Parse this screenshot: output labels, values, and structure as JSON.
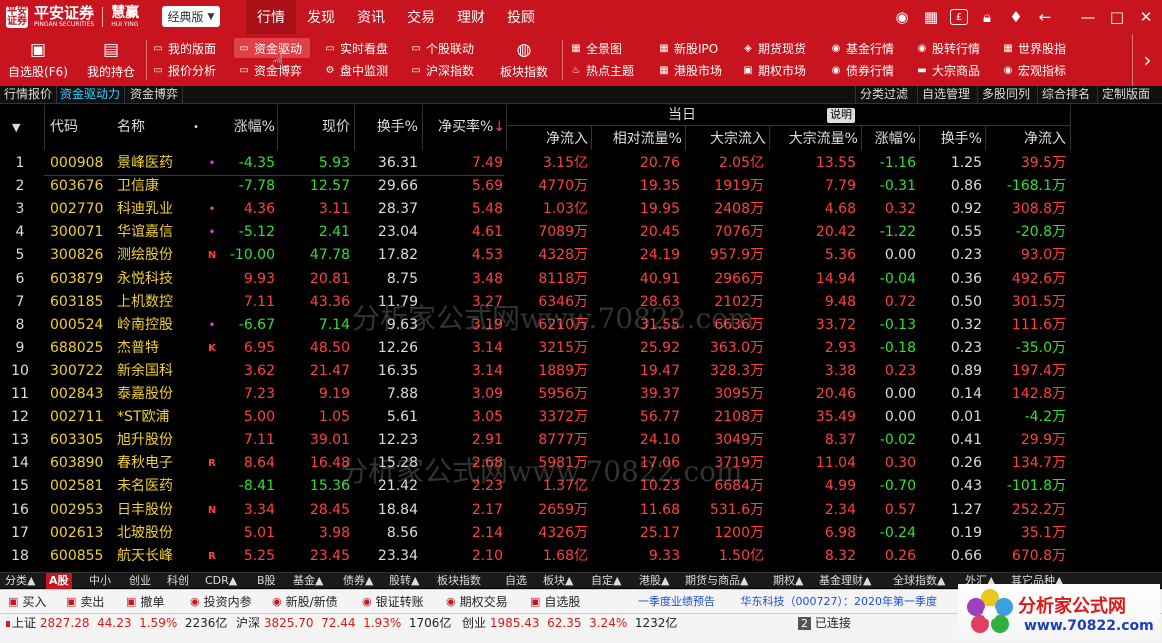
{
  "brand": {
    "badge": "平安\n证券",
    "name": "平安证券",
    "name_sub": "PINGAN SECURITIES",
    "product": "慧赢",
    "product_sub": "HUI YING"
  },
  "mode_select": {
    "value": "经典版"
  },
  "top_nav": [
    {
      "label": "行情",
      "active": true
    },
    {
      "label": "发现"
    },
    {
      "label": "资讯"
    },
    {
      "label": "交易"
    },
    {
      "label": "理财"
    },
    {
      "label": "投顾"
    }
  ],
  "top_icons": [
    "user-icon",
    "grid-icon",
    "account-icon",
    "lock-icon",
    "shirt-icon",
    "back-arrow-icon"
  ],
  "window_controls": {
    "minimize": "—",
    "maximize": "□",
    "close": "✕"
  },
  "toolbar": {
    "big_buttons": [
      {
        "label": "自选股(F6)",
        "icon": "bookmark-icon"
      },
      {
        "label": "我的持仓",
        "icon": "portfolio-icon"
      },
      {
        "label": "板块指数",
        "icon": "globe-icon"
      }
    ],
    "small_buttons": [
      {
        "label": "我的版面",
        "icon": "layout-icon"
      },
      {
        "label": "报价分析",
        "icon": "analysis-icon"
      },
      {
        "label": "资金驱动",
        "icon": "capital-drive-icon",
        "active": true
      },
      {
        "label": "资金博弈",
        "icon": "capital-game-icon"
      },
      {
        "label": "实时看盘",
        "icon": "realtime-icon"
      },
      {
        "label": "盘中监测",
        "icon": "monitor-icon"
      },
      {
        "label": "个股联动",
        "icon": "link-icon"
      },
      {
        "label": "沪深指数",
        "icon": "index-icon"
      },
      {
        "label": "全景图",
        "icon": "panorama-icon"
      },
      {
        "label": "热点主题",
        "icon": "flame-icon"
      },
      {
        "label": "新股IPO",
        "icon": "ipo-icon"
      },
      {
        "label": "港股市场",
        "icon": "hk-icon"
      },
      {
        "label": "期货现货",
        "icon": "futures-icon"
      },
      {
        "label": "期权市场",
        "icon": "options-icon"
      },
      {
        "label": "基金行情",
        "icon": "fund-icon"
      },
      {
        "label": "债券行情",
        "icon": "bond-icon"
      },
      {
        "label": "股转行情",
        "icon": "neeq-icon"
      },
      {
        "label": "大宗商品",
        "icon": "commodity-icon"
      },
      {
        "label": "世界股指",
        "icon": "world-icon"
      },
      {
        "label": "宏观指标",
        "icon": "macro-icon"
      }
    ],
    "more_arrow": "›"
  },
  "sub_tabs": [
    {
      "label": "行情报价"
    },
    {
      "label": "资金驱动力",
      "active": true
    },
    {
      "label": "资金博弈"
    }
  ],
  "filter_tabs": [
    "分类过滤",
    "自选管理",
    "多股同列",
    "综合排名",
    "定制版面"
  ],
  "table": {
    "group_title": "当日",
    "explain_label": "说明",
    "sort_caret": "▼",
    "headers": {
      "code": "代码",
      "name": "名称",
      "name_dot": "•",
      "change_pct": "涨幅%",
      "price": "现价",
      "turnover": "换手%",
      "net_buy_rate": "净买率%",
      "net_buy_arrow": "↓",
      "net_inflow": "净流入",
      "rel_flow": "相对流量%",
      "block_inflow": "大宗流入",
      "block_flow": "大宗流量%",
      "change_pct2": "涨幅%",
      "turnover2": "换手%",
      "net_inflow2": "净流入"
    },
    "rows": [
      {
        "idx": "1",
        "code": "000908",
        "name": "景峰医药",
        "flag": "•",
        "chg": "-4.35",
        "price": "5.93",
        "turn": "36.31",
        "nbr": "7.49",
        "inflow": "3.15亿",
        "rel": "20.76",
        "block": "2.05亿",
        "bflow": "13.55",
        "chg2": "-1.16",
        "turn2": "1.25",
        "inflow2": "39.5万"
      },
      {
        "idx": "2",
        "code": "603676",
        "name": "卫信康",
        "flag": "",
        "chg": "-7.78",
        "price": "12.57",
        "turn": "29.66",
        "nbr": "5.69",
        "inflow": "4770万",
        "rel": "19.35",
        "block": "1919万",
        "bflow": "7.79",
        "chg2": "-0.31",
        "turn2": "0.86",
        "inflow2": "-168.1万"
      },
      {
        "idx": "3",
        "code": "002770",
        "name": "科迪乳业",
        "flag": "•",
        "chg": "4.36",
        "price": "3.11",
        "turn": "28.37",
        "nbr": "5.48",
        "inflow": "1.03亿",
        "rel": "19.95",
        "block": "2408万",
        "bflow": "4.68",
        "chg2": "0.32",
        "turn2": "0.92",
        "inflow2": "308.8万"
      },
      {
        "idx": "4",
        "code": "300071",
        "name": "华谊嘉信",
        "flag": "•",
        "chg": "-5.12",
        "price": "2.41",
        "turn": "23.04",
        "nbr": "4.61",
        "inflow": "7089万",
        "rel": "20.45",
        "block": "7076万",
        "bflow": "20.42",
        "chg2": "-1.22",
        "turn2": "0.55",
        "inflow2": "-20.8万"
      },
      {
        "idx": "5",
        "code": "300826",
        "name": "测绘股份",
        "flag": "N",
        "chg": "-10.00",
        "price": "47.78",
        "turn": "17.82",
        "nbr": "4.53",
        "inflow": "4328万",
        "rel": "24.19",
        "block": "957.9万",
        "bflow": "5.36",
        "chg2": "0.00",
        "turn2": "0.23",
        "inflow2": "93.0万"
      },
      {
        "idx": "6",
        "code": "603879",
        "name": "永悦科技",
        "flag": "",
        "chg": "9.93",
        "price": "20.81",
        "turn": "8.75",
        "nbr": "3.48",
        "inflow": "8118万",
        "rel": "40.91",
        "block": "2966万",
        "bflow": "14.94",
        "chg2": "-0.04",
        "turn2": "0.36",
        "inflow2": "492.6万"
      },
      {
        "idx": "7",
        "code": "603185",
        "name": "上机数控",
        "flag": "",
        "chg": "7.11",
        "price": "43.36",
        "turn": "11.79",
        "nbr": "3.27",
        "inflow": "6346万",
        "rel": "28.63",
        "block": "2102万",
        "bflow": "9.48",
        "chg2": "0.72",
        "turn2": "0.50",
        "inflow2": "301.5万"
      },
      {
        "idx": "8",
        "code": "000524",
        "name": "岭南控股",
        "flag": "•",
        "chg": "-6.67",
        "price": "7.14",
        "turn": "9.63",
        "nbr": "3.19",
        "inflow": "6210万",
        "rel": "31.55",
        "block": "6636万",
        "bflow": "33.72",
        "chg2": "-0.13",
        "turn2": "0.32",
        "inflow2": "111.6万"
      },
      {
        "idx": "9",
        "code": "688025",
        "name": "杰普特",
        "flag": "K",
        "chg": "6.95",
        "price": "48.50",
        "turn": "12.26",
        "nbr": "3.14",
        "inflow": "3215万",
        "rel": "25.92",
        "block": "363.0万",
        "bflow": "2.93",
        "chg2": "-0.18",
        "turn2": "0.23",
        "inflow2": "-35.0万"
      },
      {
        "idx": "10",
        "code": "300722",
        "name": "新余国科",
        "flag": "",
        "chg": "3.62",
        "price": "21.47",
        "turn": "16.35",
        "nbr": "3.14",
        "inflow": "1889万",
        "rel": "19.47",
        "block": "328.3万",
        "bflow": "3.38",
        "chg2": "0.23",
        "turn2": "0.89",
        "inflow2": "197.4万"
      },
      {
        "idx": "11",
        "code": "002843",
        "name": "泰嘉股份",
        "flag": "",
        "chg": "7.23",
        "price": "9.19",
        "turn": "7.88",
        "nbr": "3.09",
        "inflow": "5956万",
        "rel": "39.37",
        "block": "3095万",
        "bflow": "20.46",
        "chg2": "0.00",
        "turn2": "0.14",
        "inflow2": "142.8万"
      },
      {
        "idx": "12",
        "code": "002711",
        "name": "*ST欧浦",
        "flag": "",
        "chg": "5.00",
        "price": "1.05",
        "turn": "5.61",
        "nbr": "3.05",
        "inflow": "3372万",
        "rel": "56.77",
        "block": "2108万",
        "bflow": "35.49",
        "chg2": "0.00",
        "turn2": "0.01",
        "inflow2": "-4.2万"
      },
      {
        "idx": "13",
        "code": "603305",
        "name": "旭升股份",
        "flag": "",
        "chg": "7.11",
        "price": "39.01",
        "turn": "12.23",
        "nbr": "2.91",
        "inflow": "8777万",
        "rel": "24.10",
        "block": "3049万",
        "bflow": "8.37",
        "chg2": "-0.02",
        "turn2": "0.41",
        "inflow2": "29.9万"
      },
      {
        "idx": "14",
        "code": "603890",
        "name": "春秋电子",
        "flag": "R",
        "chg": "8.64",
        "price": "16.48",
        "turn": "15.28",
        "nbr": "2.68",
        "inflow": "5981万",
        "rel": "17.06",
        "block": "3719万",
        "bflow": "11.04",
        "chg2": "0.30",
        "turn2": "0.26",
        "inflow2": "134.7万"
      },
      {
        "idx": "15",
        "code": "002581",
        "name": "未名医药",
        "flag": "",
        "chg": "-8.41",
        "price": "15.36",
        "turn": "21.42",
        "nbr": "2.23",
        "inflow": "1.37亿",
        "rel": "10.23",
        "block": "6684万",
        "bflow": "4.99",
        "chg2": "-0.70",
        "turn2": "0.43",
        "inflow2": "-101.8万"
      },
      {
        "idx": "16",
        "code": "002953",
        "name": "日丰股份",
        "flag": "N",
        "chg": "3.34",
        "price": "28.45",
        "turn": "18.84",
        "nbr": "2.17",
        "inflow": "2659万",
        "rel": "11.68",
        "block": "531.6万",
        "bflow": "2.34",
        "chg2": "0.57",
        "turn2": "1.27",
        "inflow2": "252.2万"
      },
      {
        "idx": "17",
        "code": "002613",
        "name": "北玻股份",
        "flag": "",
        "chg": "5.01",
        "price": "3.98",
        "turn": "8.56",
        "nbr": "2.14",
        "inflow": "4326万",
        "rel": "25.17",
        "block": "1200万",
        "bflow": "6.98",
        "chg2": "-0.24",
        "turn2": "0.19",
        "inflow2": "35.1万"
      },
      {
        "idx": "18",
        "code": "600855",
        "name": "航天长峰",
        "flag": "R",
        "chg": "5.25",
        "price": "23.45",
        "turn": "23.34",
        "nbr": "2.10",
        "inflow": "1.68亿",
        "rel": "9.33",
        "block": "1.50亿",
        "bflow": "8.32",
        "chg2": "0.26",
        "turn2": "0.66",
        "inflow2": "670.8万"
      }
    ]
  },
  "watermark": "分析家公式网www.70822.com",
  "bottom_tabs": [
    "分类▲",
    "A股",
    "中小",
    "创业",
    "科创",
    "CDR▲",
    "B股",
    "基金▲",
    "债券▲",
    "股转▲",
    "板块指数",
    "自选",
    "板块▲",
    "自定▲",
    "港股▲",
    "期货与商品▲",
    "期权▲",
    "基金理财▲",
    "全球指数▲",
    "外汇▲",
    "其它品种▲"
  ],
  "bottom_active": "A股",
  "actions": [
    {
      "label": "买入",
      "icon": "buy-icon"
    },
    {
      "label": "卖出",
      "icon": "sell-icon"
    },
    {
      "label": "撤单",
      "icon": "cancel-order-icon"
    },
    {
      "label": "投资内参",
      "icon": "report-icon"
    },
    {
      "label": "新股/新债",
      "icon": "new-stock-icon"
    },
    {
      "label": "银证转账",
      "icon": "transfer-icon"
    },
    {
      "label": "期权交易",
      "icon": "options-trade-icon"
    },
    {
      "label": "自选股",
      "icon": "watchlist-icon"
    }
  ],
  "news": {
    "item1": "一季度业绩预告",
    "item2": "华东科技（000727）：2020年第一季度"
  },
  "status": {
    "sh_label": "上证",
    "sh_value": "2827.28",
    "sh_change": "44.23",
    "sh_pct": "1.59%",
    "sh_amount": "2236亿",
    "hs_label": "沪深",
    "hs_value": "3825.70",
    "hs_change": "72.44",
    "hs_pct": "1.93%",
    "hs_amount": "1706亿",
    "cy_label": "创业",
    "cy_value": "1985.43",
    "cy_change": "62.35",
    "cy_pct": "3.24%",
    "cy_amount": "1232亿",
    "conn_count": "2",
    "conn_label": "已连接"
  },
  "ad": {
    "title": "分析家公式网",
    "url": "www.70822.com"
  }
}
